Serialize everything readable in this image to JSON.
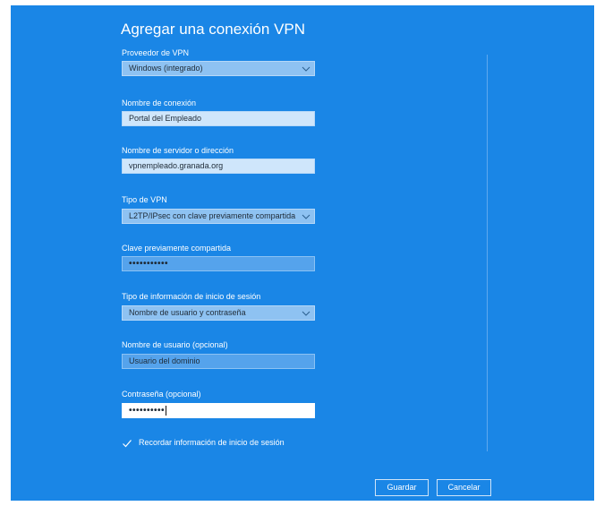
{
  "dialog": {
    "title": "Agregar una conexión VPN",
    "fields": [
      {
        "label": "Proveedor de VPN",
        "value": "Windows (integrado)",
        "type": "dropdown"
      },
      {
        "label": "Nombre de conexión",
        "value": "Portal del Empleado",
        "type": "text"
      },
      {
        "label": "Nombre de servidor o dirección",
        "value": "vpnempleado.granada.org",
        "type": "text"
      },
      {
        "label": "Tipo de VPN",
        "value": "L2TP/IPsec con clave previamente compartida",
        "type": "dropdown"
      },
      {
        "label": "Clave previamente compartida",
        "value": "•••••••••••",
        "type": "password"
      },
      {
        "label": "Tipo de información de inicio de sesión",
        "value": "Nombre de usuario y contraseña",
        "type": "dropdown"
      },
      {
        "label": "Nombre de usuario (opcional)",
        "value": "Usuario del dominio",
        "type": "text"
      },
      {
        "label": "Contraseña (opcional)",
        "value": "••••••••••",
        "type": "password"
      }
    ],
    "remember": {
      "label": "Recordar información de inicio de sesión",
      "checked": true
    },
    "buttons": {
      "save": "Guardar",
      "cancel": "Cancelar"
    }
  },
  "colors": {
    "background": "#1a86e6",
    "field": "#8ec2f2",
    "field_active": "#ffffff"
  },
  "icons": [
    "chevron-down-icon",
    "checkmark-icon"
  ]
}
